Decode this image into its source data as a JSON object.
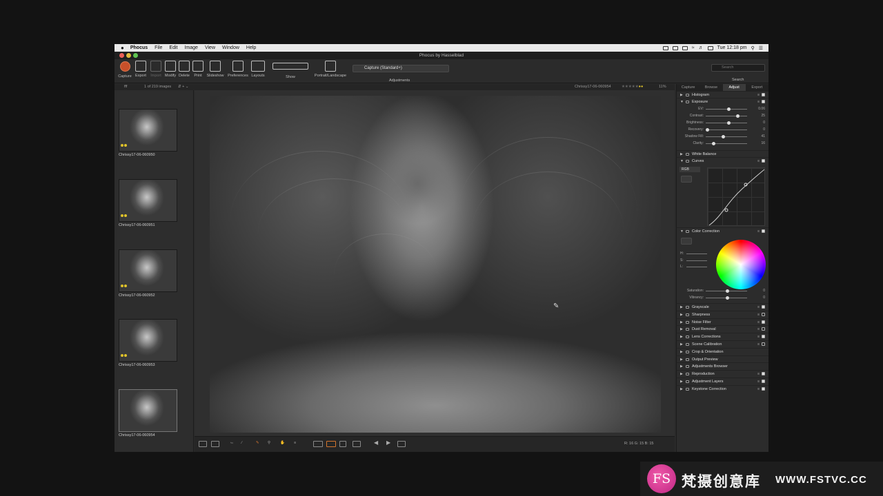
{
  "menubar": {
    "apple": "",
    "items": [
      "Phocus",
      "File",
      "Edit",
      "Image",
      "View",
      "Window",
      "Help"
    ],
    "clock": "Tue 12:18 pm"
  },
  "window": {
    "title": "Phocus by Hasselblad"
  },
  "toolbar": {
    "buttons": [
      "Capture",
      "Export",
      "Import",
      "Modify",
      "Delete",
      "Print",
      "Slideshow",
      "Preferences",
      "Layouts",
      "Show",
      "Portrait/Landscape"
    ],
    "preset": "Capture (Standard+)",
    "adjustments_label": "Adjustments",
    "search_placeholder": "Search",
    "search_label": "Search"
  },
  "browser": {
    "folder": "fff",
    "count": "1 of 219 images",
    "current_file": "Chrissy17-06-060954",
    "zoom": "11%",
    "thumbnails": [
      "Chrissy17-06-060950",
      "Chrissy17-06-060951",
      "Chrissy17-06-060952",
      "Chrissy17-06-060953",
      "Chrissy17-06-060954"
    ]
  },
  "statusbar": {
    "readout": "R: 16  G: 15  B: 15"
  },
  "panel": {
    "tabs": [
      "Capture",
      "Browse",
      "Adjust",
      "Export"
    ],
    "active_tab": "Adjust",
    "sections_top": [
      "Histogram",
      "Exposure"
    ],
    "exposure_sliders": [
      {
        "label": "EV:",
        "value": "0.06",
        "pos": 0.55
      },
      {
        "label": "Contrast:",
        "value": "25",
        "pos": 0.78
      },
      {
        "label": "Brightness:",
        "value": "0",
        "pos": 0.55
      },
      {
        "label": "Recovery:",
        "value": "0",
        "pos": 0.0
      },
      {
        "label": "Shadow Fill:",
        "value": "41",
        "pos": 0.41
      },
      {
        "label": "Clarity:",
        "value": "16",
        "pos": 0.16
      }
    ],
    "white_balance": "White Balance",
    "curves": "Curves",
    "curves_channel": "RGB",
    "color_correction": "Color Correction",
    "hsl_labels": [
      "H:",
      "S:",
      "L:"
    ],
    "cc_sliders": [
      {
        "label": "Saturation:",
        "value": "0",
        "pos": 0.5
      },
      {
        "label": "Vibrancy:",
        "value": "0",
        "pos": 0.5
      }
    ],
    "sections_bottom": [
      "Grayscale",
      "Sharpness",
      "Noise Filter",
      "Dust Removal",
      "Lens Corrections",
      "Scene Calibration",
      "Crop & Orientation",
      "Output Preview",
      "Adjustments Browser",
      "Reproduction",
      "Adjustment Layers",
      "Keystone Correction"
    ],
    "sections_bottom_checked": [
      true,
      false,
      true,
      false,
      true,
      false,
      null,
      null,
      null,
      true,
      true,
      true
    ]
  },
  "watermark": {
    "logo": "FS",
    "cn": "梵摄创意库",
    "url": "WWW.FSTVC.CC"
  }
}
